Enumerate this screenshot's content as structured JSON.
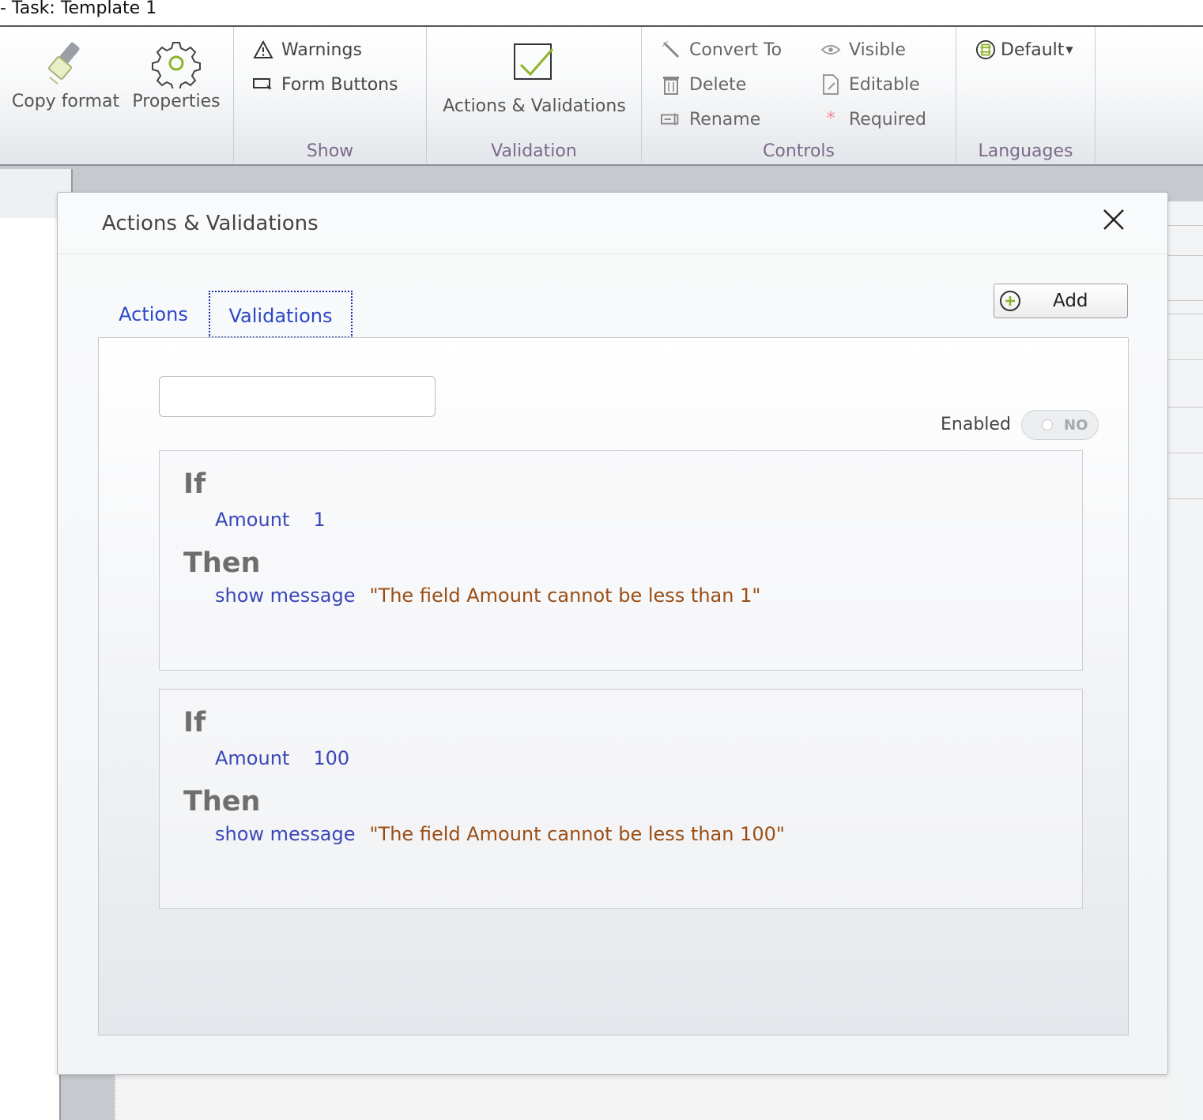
{
  "window": {
    "title": "- Task:  Template 1"
  },
  "ribbon": {
    "clipboard": {
      "copy_format": "Copy format",
      "properties": "Properties"
    },
    "show": {
      "label": "Show",
      "warnings": "Warnings",
      "form_buttons": "Form Buttons"
    },
    "validation": {
      "label": "Validation",
      "actions_validations": "Actions & Validations"
    },
    "controls": {
      "label": "Controls",
      "convert_to": "Convert To",
      "delete": "Delete",
      "rename": "Rename",
      "visible": "Visible",
      "editable": "Editable",
      "required": "Required"
    },
    "languages": {
      "label": "Languages",
      "default": "Default"
    }
  },
  "dialog": {
    "title": "Actions & Validations",
    "tabs": [
      {
        "label": "Actions",
        "active": false
      },
      {
        "label": "Validations",
        "active": true
      }
    ],
    "add_label": "Add",
    "name_input": {
      "value": "",
      "placeholder": ""
    },
    "enabled": {
      "label": "Enabled",
      "state": "NO"
    },
    "rules": [
      {
        "if_label": "If",
        "field": "Amount",
        "value": "1",
        "then_label": "Then",
        "action": "show message",
        "message": "\"The field Amount cannot be less than 1\""
      },
      {
        "if_label": "If",
        "field": "Amount",
        "value": "100",
        "then_label": "Then",
        "action": "show message",
        "message": "\"The field Amount cannot be less than 100\""
      }
    ]
  },
  "colors": {
    "keyword": "#6e6e6e",
    "link_blue": "#3a47b8",
    "message_brown": "#9a4e16",
    "group_label": "#7b6a8a"
  }
}
